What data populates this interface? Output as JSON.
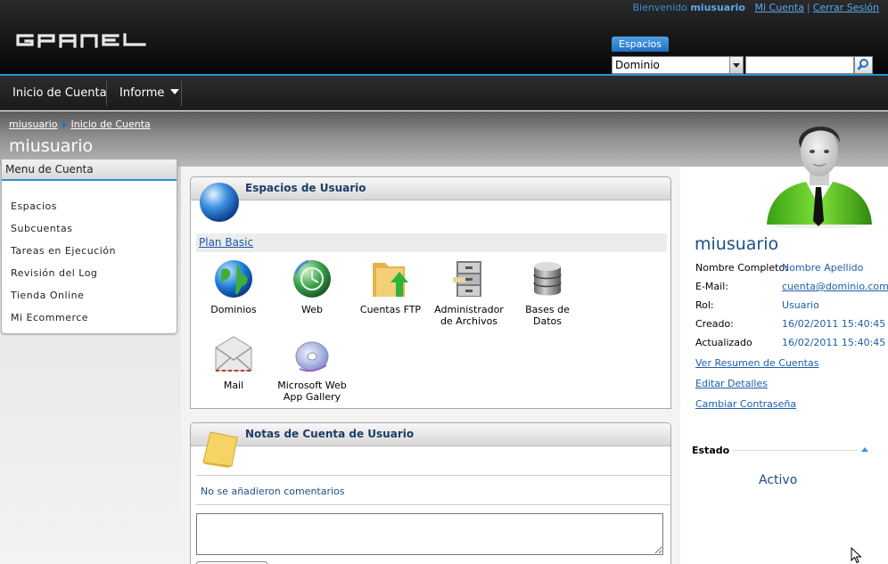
{
  "header": {
    "welcome_prefix": "Bienvenido",
    "username": "miusuario",
    "my_account": "Mi Cuenta",
    "separator": "|",
    "logout": "Cerrar Sesión",
    "logo_text": "GPANEL",
    "spaces_tab": "Espacios",
    "search_select_value": "Dominio",
    "search_placeholder": ""
  },
  "nav": {
    "items": [
      {
        "label": "Inicio de Cuenta"
      },
      {
        "label": "Informe"
      }
    ]
  },
  "breadcrumb": {
    "items": [
      "miusuario",
      "Inicio de Cuenta"
    ]
  },
  "page_title": "miusuario",
  "menu": {
    "title": "Menu de Cuenta",
    "items": [
      "Espacios",
      "Subcuentas",
      "Tareas en Ejecución",
      "Revisión del Log",
      "Tienda Online",
      "Mi Ecommerce"
    ]
  },
  "spaces_panel": {
    "title": "Espacios de Usuario",
    "plan": "Plan Basic",
    "tiles": [
      {
        "label": "Dominios",
        "icon": "globe-icon"
      },
      {
        "label": "Web",
        "icon": "web-globe-icon"
      },
      {
        "label": "Cuentas FTP",
        "icon": "ftp-folder-icon"
      },
      {
        "label": "Administrador de Archivos",
        "icon": "file-cabinet-icon"
      },
      {
        "label": "Bases de Datos",
        "icon": "database-icon"
      },
      {
        "label": "Mail",
        "icon": "mail-envelope-icon"
      },
      {
        "label": "Microsoft Web App Gallery",
        "icon": "cd-disc-icon"
      }
    ]
  },
  "notes_panel": {
    "title": "Notas de Cuenta de Usuario",
    "empty_text": "No se añadieron comentarios"
  },
  "user": {
    "name": "miusuario",
    "fields": [
      {
        "label": "Nombre Completo:",
        "value": "Nombre Apellido",
        "link": false
      },
      {
        "label": "E-Mail:",
        "value": "cuenta@dominio.com.ar",
        "link": true
      },
      {
        "label": "Rol:",
        "value": "Usuario",
        "link": false
      },
      {
        "label": "Creado:",
        "value": "16/02/2011 15:40:45",
        "link": false
      },
      {
        "label": "Actualizado",
        "value": "16/02/2011 15:40:45",
        "link": false
      }
    ],
    "links": [
      "Ver Resumen de Cuentas",
      "Editar Detalles",
      "Cambiar Contraseña"
    ],
    "status_title": "Estado",
    "status_value": "Activo"
  },
  "colors": {
    "accent": "#2b8fd6",
    "link": "#1b5fa8",
    "title_blue": "#1b4f84"
  }
}
